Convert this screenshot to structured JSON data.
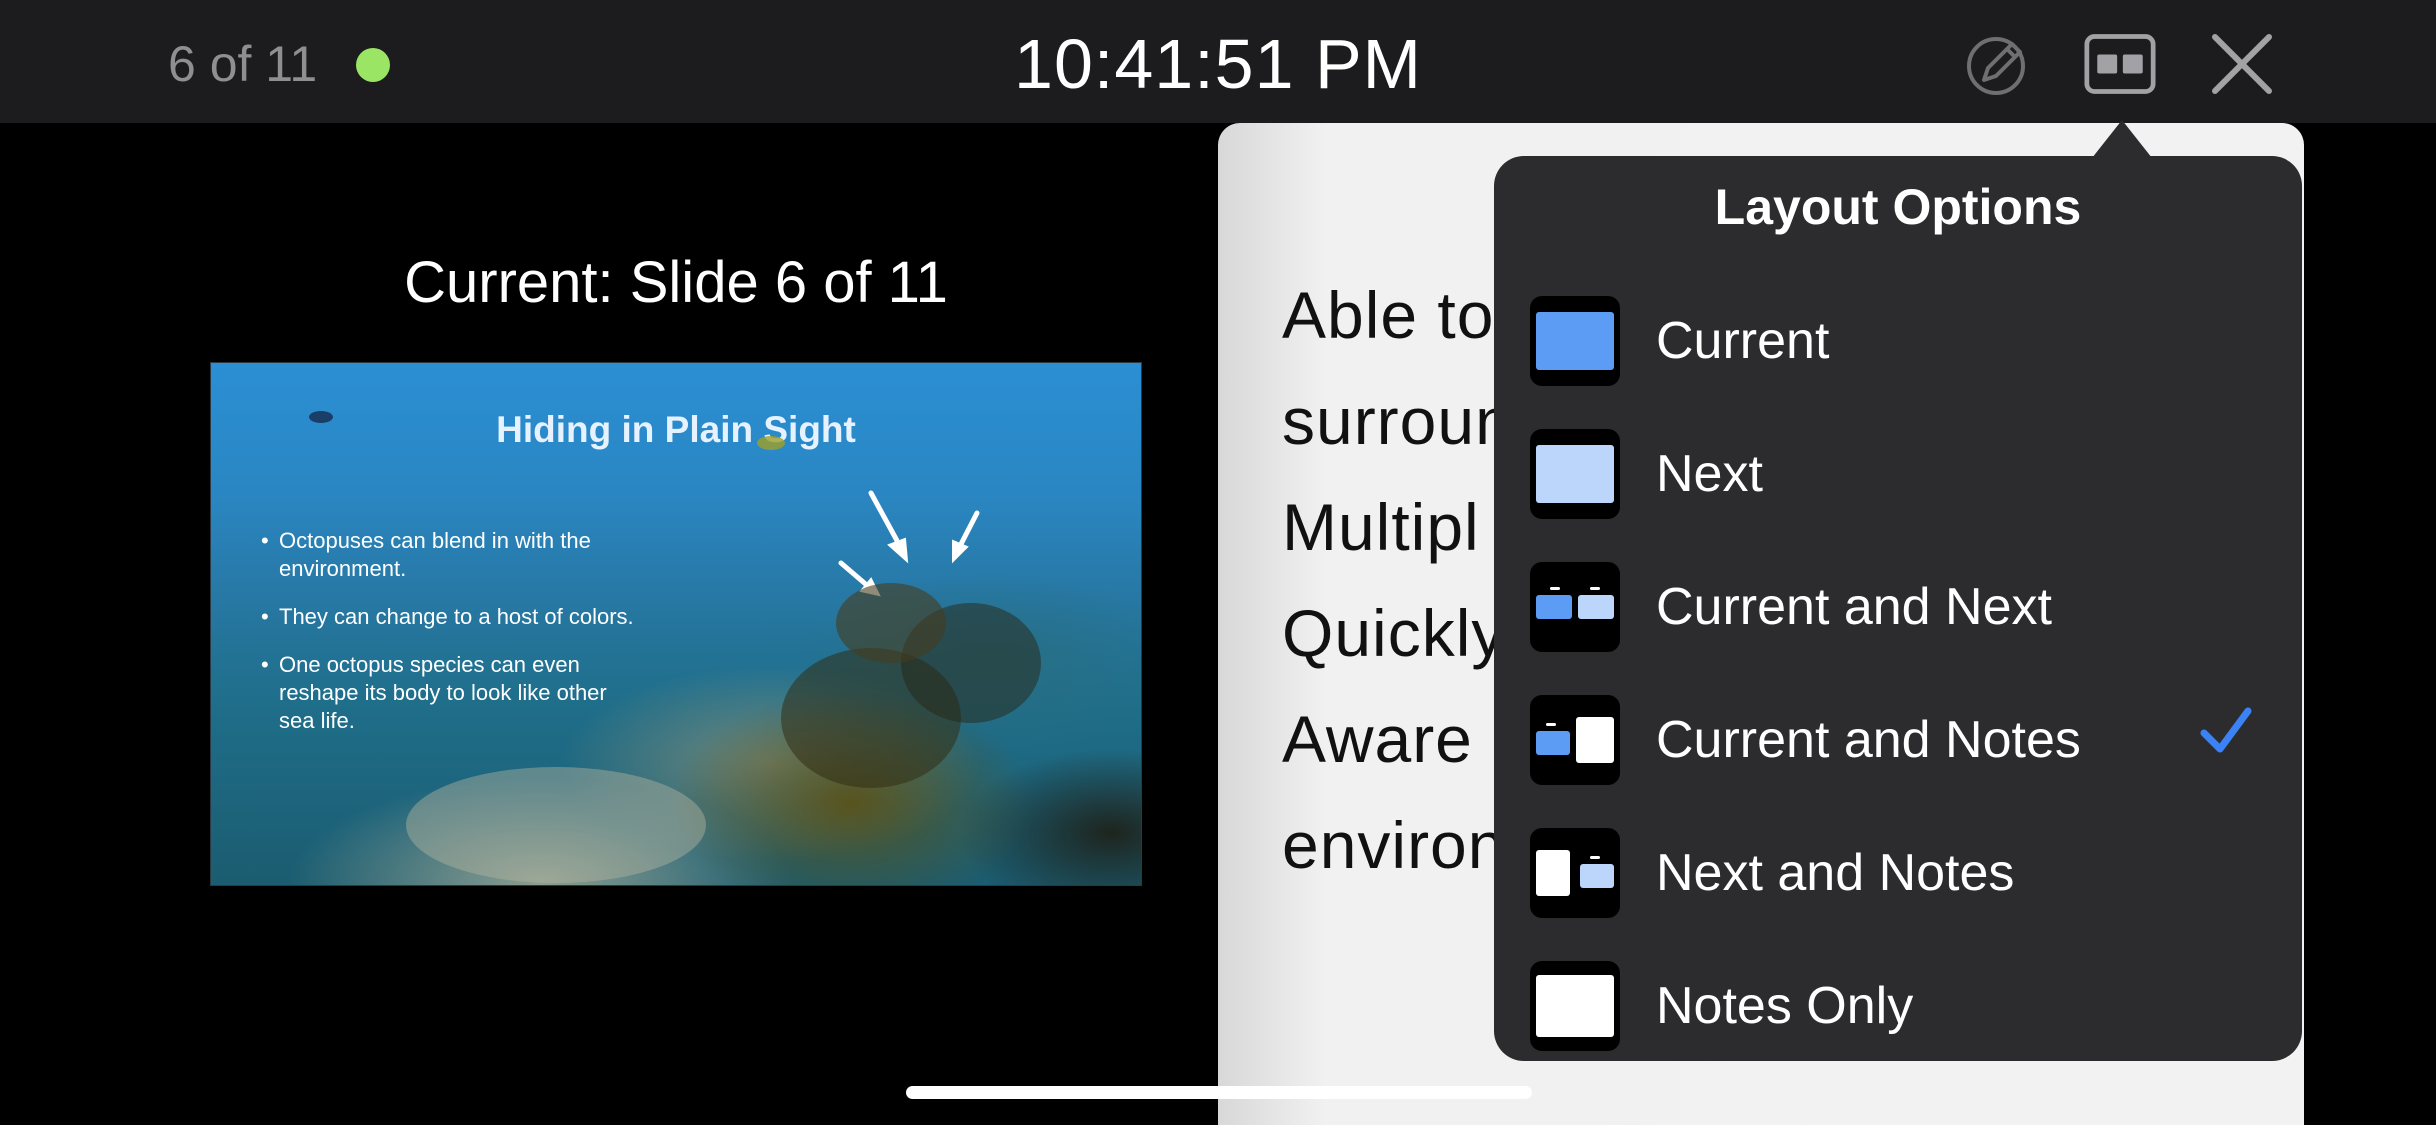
{
  "topbar": {
    "slide_counter": "6 of 11",
    "clock": "10:41:51 PM",
    "status_color": "#9be564",
    "icons": [
      "pencil-circle-icon",
      "layout-icon",
      "close-icon"
    ]
  },
  "current": {
    "label": "Current: Slide 6 of 11",
    "slide": {
      "title": "Hiding in Plain Sight",
      "bullets": [
        "Octopuses can blend in with the environment.",
        "They can change to a host of colors.",
        "One octopus species can even reshape its body to look like other sea life."
      ]
    }
  },
  "notes": {
    "lines": [
      "Able to",
      "surroun",
      "Multipl",
      "Quickly",
      "Aware o",
      "environ"
    ]
  },
  "layout_options": {
    "title": "Layout Options",
    "selected": "Current and Notes",
    "accent": "#3b82f6",
    "items": [
      {
        "label": "Current",
        "icon": "current-layout-icon"
      },
      {
        "label": "Next",
        "icon": "next-layout-icon"
      },
      {
        "label": "Current and Next",
        "icon": "current-and-next-layout-icon"
      },
      {
        "label": "Current and Notes",
        "icon": "current-and-notes-layout-icon",
        "checked": true
      },
      {
        "label": "Next and Notes",
        "icon": "next-and-notes-layout-icon"
      },
      {
        "label": "Notes Only",
        "icon": "notes-only-layout-icon"
      }
    ]
  }
}
